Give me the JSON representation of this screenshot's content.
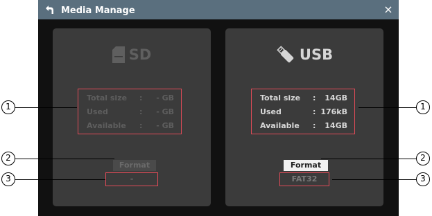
{
  "window": {
    "title": "Media Manage",
    "back_icon": "back-arrow-icon",
    "close_glyph": "×"
  },
  "sd": {
    "label": "SD",
    "icon": "sd-card-icon",
    "rows": [
      {
        "key": "Total size",
        "sep": ":",
        "value": "- GB"
      },
      {
        "key": "Used",
        "sep": ":",
        "value": "- GB"
      },
      {
        "key": "Available",
        "sep": ":",
        "value": "- GB"
      }
    ],
    "format_label": "Format",
    "filesystem": "-"
  },
  "usb": {
    "label": "USB",
    "icon": "usb-drive-icon",
    "rows": [
      {
        "key": "Total size",
        "sep": ":",
        "value": "14GB"
      },
      {
        "key": "Used",
        "sep": ":",
        "value": "176kB"
      },
      {
        "key": "Available",
        "sep": ":",
        "value": "14GB"
      }
    ],
    "format_label": "Format",
    "filesystem": "FAT32"
  },
  "callouts": {
    "one": "1",
    "two": "2",
    "three": "3"
  },
  "colors": {
    "titlebar": "#5a6f7e",
    "background": "#111111",
    "panel": "#3b3b3b",
    "highlight_border": "#e24b58"
  }
}
